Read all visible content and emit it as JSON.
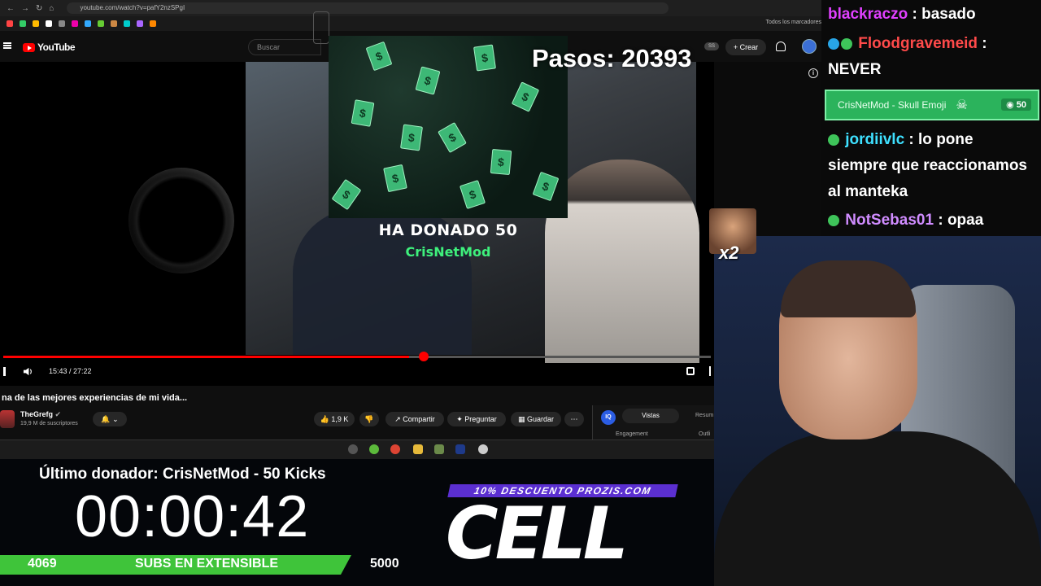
{
  "browser": {
    "url": "youtube.com/watch?v=pafY2nzSPgI",
    "bookmarks_all": "Todos los marcadores"
  },
  "yt_header": {
    "logo": "YouTube",
    "search_placeholder": "Buscar",
    "account_badge": "SS",
    "create_label": "+ Crear"
  },
  "overlay": {
    "steps": "Pasos: 20393",
    "donation_title": "HA DONADO 50",
    "donation_name": "CrisNetMod",
    "emote_multiplier": "x2"
  },
  "player": {
    "time": "15:43 / 27:22",
    "progress": 0.574
  },
  "video": {
    "title": "na de las mejores experiencias de mi vida...",
    "channel": "TheGrefg",
    "channel_badge": "verified-badge-icon",
    "subscribers": "19,9 M de suscriptores",
    "likes": "1,9 K",
    "share": "Compartir",
    "ask": "Preguntar",
    "save": "Guardar"
  },
  "extension": {
    "logo": "IQ",
    "tab_active": "Vistas",
    "tab_other": "Resum",
    "label_left": "Engagement",
    "label_right": "Outli"
  },
  "stream": {
    "last_donor": "Último donador: CrisNetMod - 50 Kicks",
    "timer": "00:00:42",
    "subs_current": "4069",
    "subs_label": "SUBS EN EXTENSIBLE",
    "subs_goal": "5000",
    "promo": "10% DESCUENTO PROZIS.COM",
    "sponsor": "CELL"
  },
  "chat": {
    "messages": [
      {
        "user": "blackraczo",
        "text": " : basado",
        "user_color": "#e040ff"
      },
      {
        "user": "Floodgravemeid",
        "text": " :",
        "text2": "NEVER",
        "user_color": "#ff4a4a"
      },
      {
        "user": "jordiivlc",
        "text": " : lo pone",
        "text2": "siempre que reaccionamos",
        "text3": "al manteka",
        "user_color": "#3ee0ff"
      },
      {
        "user": "NotSebas01",
        "text": " : opaa",
        "user_color": "#d08cff"
      }
    ],
    "redeem": {
      "label": "CrisNetMod - Skull Emoji",
      "cost": "50"
    }
  },
  "colors": {
    "accent_red": "#ff0000",
    "kick_green": "#3fc43a",
    "promo_purple": "#5b2fd1"
  }
}
